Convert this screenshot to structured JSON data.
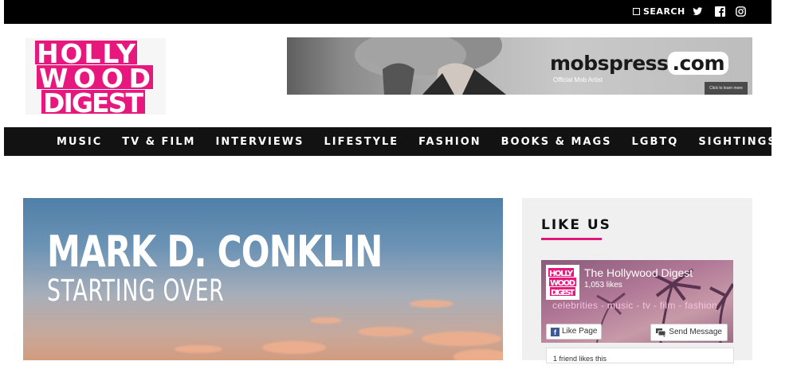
{
  "topbar": {
    "search_label": "SEARCH",
    "social": [
      "twitter-icon",
      "facebook-icon",
      "instagram-icon"
    ]
  },
  "logo": {
    "lines": [
      "HOLLY",
      "WOOD",
      "DIGEST"
    ],
    "brand_color": "#e8177d"
  },
  "banner": {
    "brand": "mobspress",
    "brand_suffix": ".com",
    "subtitle": "Official Mob Artist",
    "cta": "Click to learn more"
  },
  "nav": {
    "items": [
      "MUSIC",
      "TV & FILM",
      "INTERVIEWS",
      "LIFESTYLE",
      "FASHION",
      "BOOKS & MAGS",
      "LGBTQ",
      "SIGHTINGS"
    ]
  },
  "hero": {
    "title": "MARK D. CONKLIN",
    "subtitle": "STARTING OVER"
  },
  "sidebar": {
    "heading": "LIKE US",
    "accent": "#e0177d",
    "fb": {
      "page_name": "The Hollywood Digest",
      "likes": "1,053 likes",
      "tagline": "celebrities - music - tv - film - fashion",
      "like_button": "Like Page",
      "message_button": "Send Message",
      "friends": "1 friend likes this"
    }
  }
}
